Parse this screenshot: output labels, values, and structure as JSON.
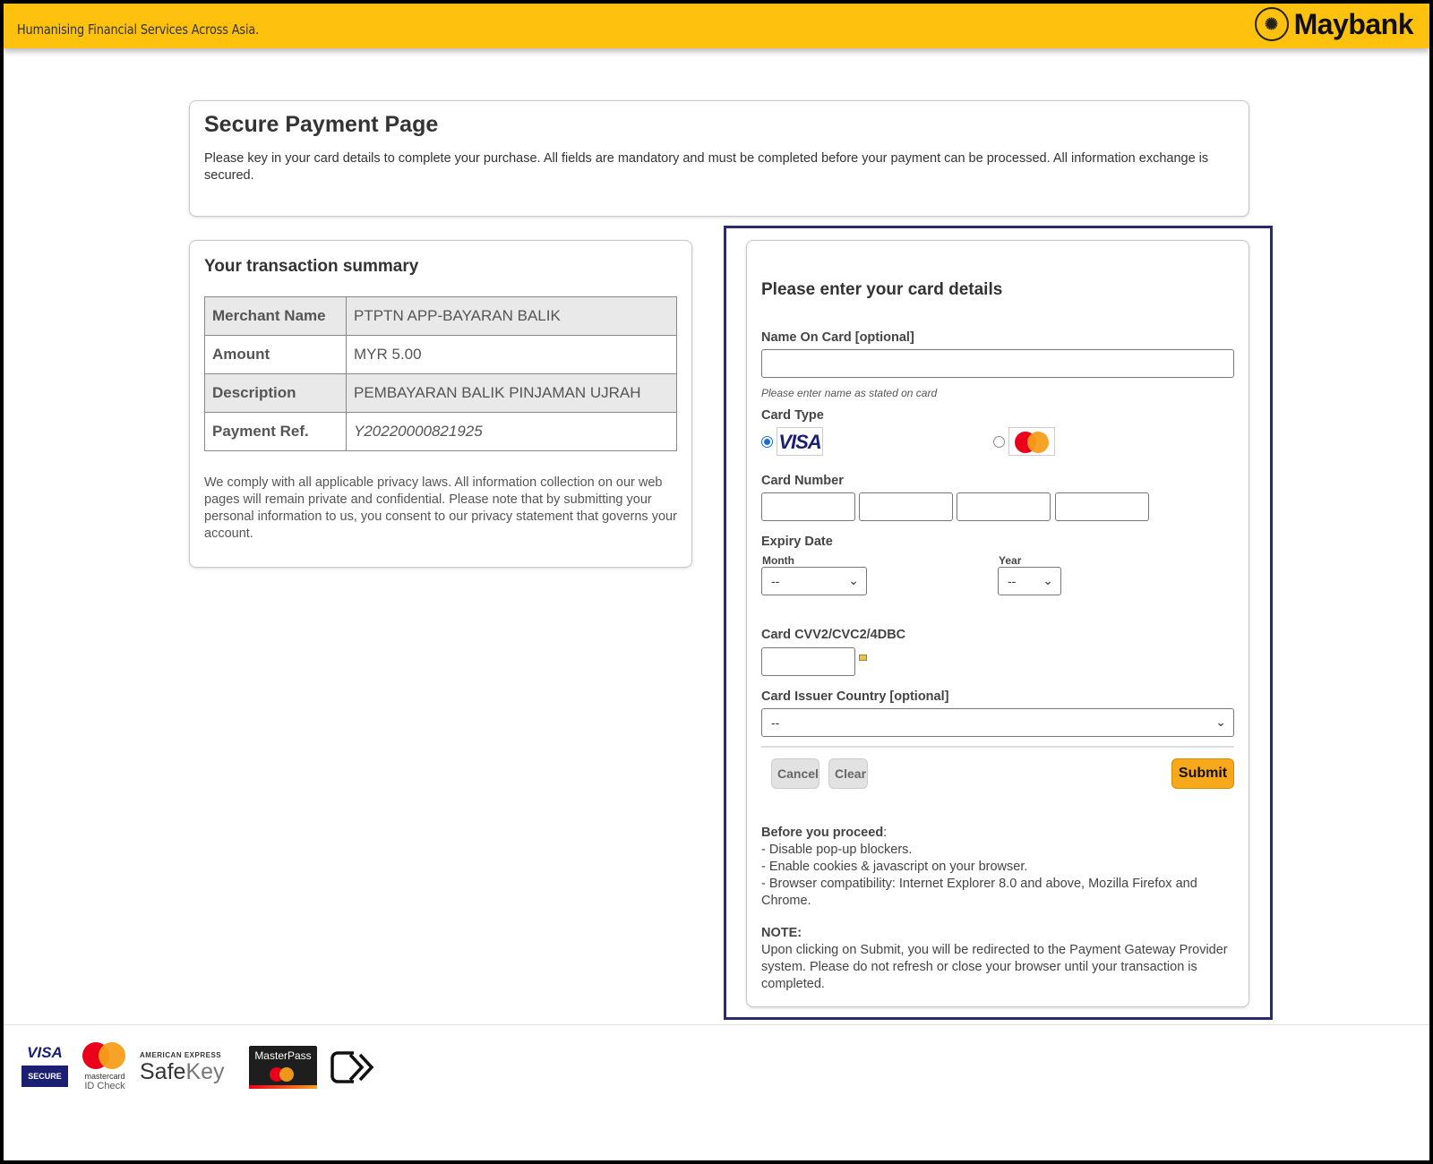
{
  "header": {
    "tagline": "Humanising Financial Services Across Asia.",
    "brand": "Maybank"
  },
  "intro": {
    "title": "Secure Payment Page",
    "text": "Please key in your card details to complete your purchase. All fields are mandatory and must be completed before your payment can be processed. All information exchange is secured."
  },
  "summary": {
    "title": "Your transaction summary",
    "rows": [
      {
        "label": "Merchant Name",
        "value": "PTPTN APP-BAYARAN BALIK"
      },
      {
        "label": "Amount",
        "value": "MYR 5.00"
      },
      {
        "label": "Description",
        "value": "PEMBAYARAN BALIK PINJAMAN UJRAH"
      },
      {
        "label": "Payment Ref.",
        "value": "Y20220000821925"
      }
    ],
    "privacy": "We comply with all applicable privacy laws. All information collection on our web pages will remain private and confidential. Please note that by submitting your personal information to us, you consent to our privacy statement that governs your account."
  },
  "card": {
    "title": "Please enter your card details",
    "name_label": "Name On Card [optional]",
    "name_value": "",
    "name_hint": "Please enter name as stated on card",
    "type_label": "Card Type",
    "visa_text": "VISA",
    "number_label": "Card Number",
    "expiry_label": "Expiry Date",
    "month_label": "Month",
    "month_value": "--",
    "year_label": "Year",
    "year_value": "--",
    "cvv_label": "Card CVV2/CVC2/4DBC",
    "country_label": "Card Issuer Country [optional]",
    "country_value": "--",
    "cancel": "Cancel",
    "clear": "Clear",
    "submit": "Submit",
    "before_title": "Before you proceed",
    "before_items": [
      "- Disable pop-up blockers.",
      "- Enable cookies & javascript on your browser.",
      "- Browser compatibility: Internet Explorer 8.0 and above, Mozilla Firefox and Chrome."
    ],
    "note_title": "NOTE:",
    "note_text": "Upon clicking on Submit, you will be redirected to the Payment Gateway Provider system. Please do not refresh or close your browser until your transaction is completed."
  },
  "footer": {
    "visa_secure_top": "VISA",
    "visa_secure_bottom": "SECURE",
    "mc_id_check_brand": "mastercard",
    "mc_id_check_text": "ID Check",
    "amex_top": "AMERICAN EXPRESS",
    "amex_safekey_safe": "Safe",
    "amex_safekey_key": "Key",
    "masterpass": "MasterPass"
  },
  "colors": {
    "header_yellow": "#fec10e",
    "submit_orange": "#f7a81b",
    "highlight_navy": "#2b2b6b"
  }
}
